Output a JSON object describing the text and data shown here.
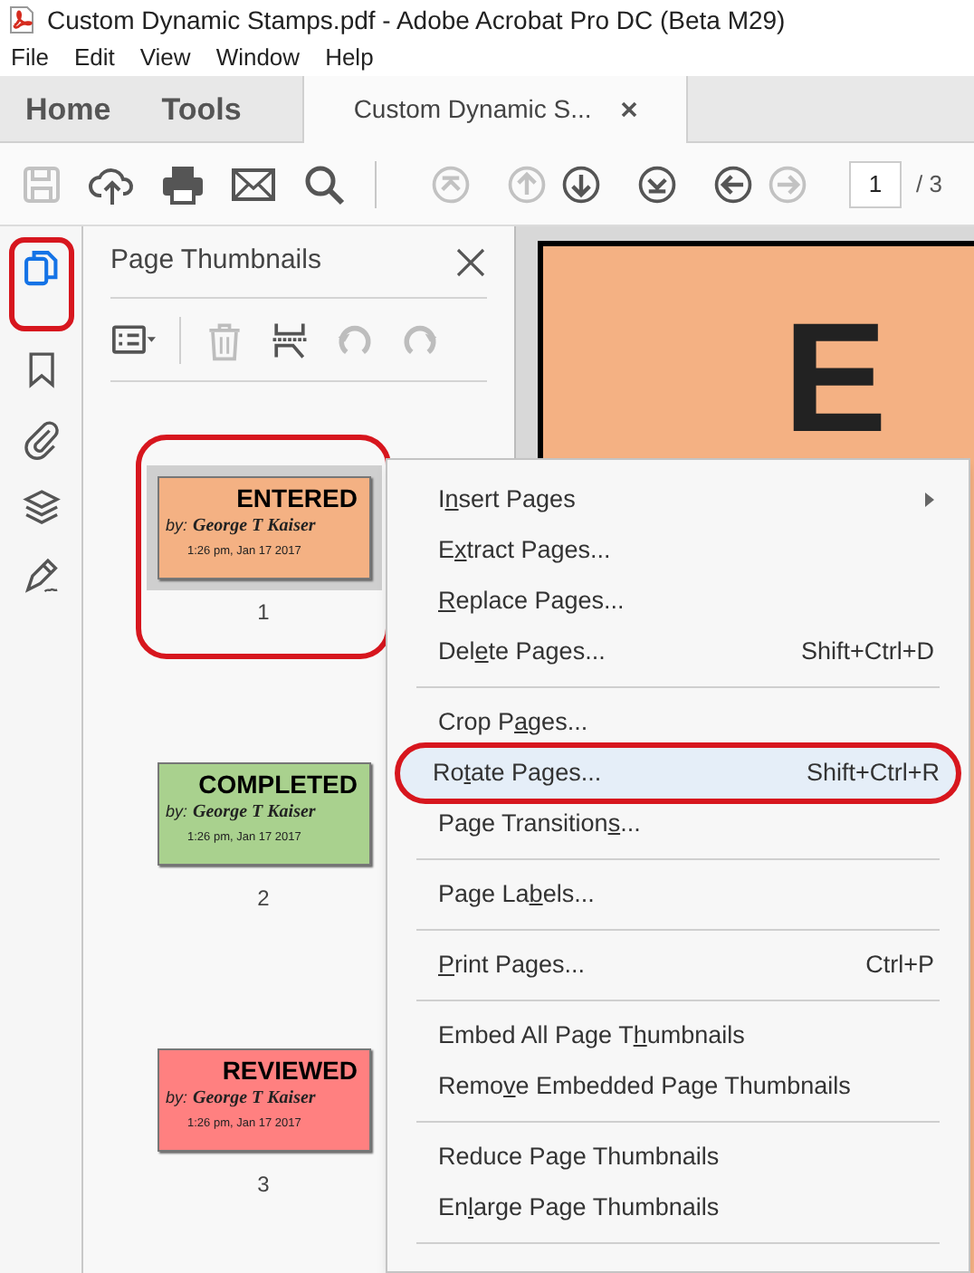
{
  "window": {
    "title": "Custom Dynamic Stamps.pdf - Adobe Acrobat Pro DC (Beta M29)"
  },
  "menu_bar": [
    "File",
    "Edit",
    "View",
    "Window",
    "Help"
  ],
  "tabs": [
    {
      "label": "Home",
      "kind": "nav",
      "selected": false
    },
    {
      "label": "Tools",
      "kind": "nav",
      "selected": false
    },
    {
      "label": "Custom Dynamic S...",
      "kind": "document",
      "selected": true
    }
  ],
  "toolbar": {
    "file_tools": [
      {
        "kind": "save",
        "disabled": true
      },
      {
        "kind": "upload",
        "disabled": false
      },
      {
        "kind": "print",
        "disabled": false
      },
      {
        "kind": "mail",
        "disabled": false
      },
      {
        "kind": "search",
        "disabled": false
      }
    ],
    "nav_tools": [
      {
        "kind": "first",
        "disabled": true
      },
      {
        "kind": "up",
        "disabled": true
      },
      {
        "kind": "down",
        "disabled": false
      },
      {
        "kind": "last",
        "disabled": false
      },
      {
        "kind": "back",
        "disabled": false
      },
      {
        "kind": "forward",
        "disabled": true
      }
    ],
    "page_field": {
      "value": "1"
    },
    "page_total": "/ 3"
  },
  "side_rail": [
    {
      "kind": "pages",
      "selected": true,
      "circled": true
    },
    {
      "kind": "bookmark",
      "selected": false,
      "circled": false
    },
    {
      "kind": "attachment",
      "selected": false,
      "circled": false
    },
    {
      "kind": "layers",
      "selected": false,
      "circled": false
    },
    {
      "kind": "signature",
      "selected": false,
      "circled": false
    }
  ],
  "thumbnails_panel": {
    "title": "Page Thumbnails",
    "tools": [
      {
        "kind": "options",
        "disabled": false
      },
      {
        "kind": "delete",
        "disabled": true
      },
      {
        "kind": "insert",
        "disabled": false
      },
      {
        "kind": "rotate_left",
        "disabled": true
      },
      {
        "kind": "rotate_right",
        "disabled": true
      }
    ],
    "pages": [
      {
        "label": "1",
        "selected": true,
        "circled": true,
        "stamp": {
          "title": "ENTERED",
          "by": "by:",
          "name": "George T Kaiser",
          "time": "1:26 pm, Jan 17 2017",
          "color": "#f4b183"
        }
      },
      {
        "label": "2",
        "selected": false,
        "circled": false,
        "stamp": {
          "title": "COMPLETED",
          "by": "by:",
          "name": "George T Kaiser",
          "time": "1:26 pm, Jan 17 2017",
          "color": "#a9d18e"
        }
      },
      {
        "label": "3",
        "selected": false,
        "circled": false,
        "stamp": {
          "title": "REVIEWED",
          "by": "by:",
          "name": "George T Kaiser",
          "time": "1:26 pm, Jan 17 2017",
          "color": "#ff8080"
        }
      }
    ]
  },
  "document": {
    "visible_text": "E",
    "color": "#f4b183"
  },
  "context_menu": {
    "items": [
      {
        "label": [
          "I",
          "n",
          "sert Pages"
        ],
        "submenu": true,
        "selected": false,
        "circled": false
      },
      {
        "label": [
          "E",
          "x",
          "tract Pages..."
        ],
        "selected": false,
        "circled": false
      },
      {
        "label": [
          "R",
          "eplace Pages..."
        ],
        "selected": false,
        "circled": false
      },
      {
        "label": [
          "Del",
          "e",
          "te Pages..."
        ],
        "shortcut": "Shift+Ctrl+D",
        "selected": false,
        "circled": false,
        "separator_after": true
      },
      {
        "label": [
          "Crop P",
          "a",
          "ges..."
        ],
        "selected": false,
        "circled": false
      },
      {
        "label": [
          "Ro",
          "t",
          "ate Pages..."
        ],
        "shortcut": "Shift+Ctrl+R",
        "selected": true,
        "circled": true
      },
      {
        "label": [
          "Page Transition",
          "s",
          "..."
        ],
        "selected": false,
        "circled": false,
        "separator_after": true
      },
      {
        "label": [
          "Page La",
          "b",
          "els..."
        ],
        "selected": false,
        "circled": false,
        "separator_after": true
      },
      {
        "label": [
          "P",
          "rint Pages..."
        ],
        "shortcut": "Ctrl+P",
        "selected": false,
        "circled": false,
        "separator_after": true
      },
      {
        "label": [
          "Embed All Page T",
          "h",
          "umbnails"
        ],
        "selected": false,
        "circled": false
      },
      {
        "label": [
          "Remo",
          "v",
          "e Embedded Page Thumbnails"
        ],
        "selected": false,
        "circled": false,
        "separator_after": true
      },
      {
        "label": [
          "Reduce Pa",
          "g",
          "e Thumbnails"
        ],
        "selected": false,
        "circled": false
      },
      {
        "label": [
          "En",
          "l",
          "arge Page Thumbnails"
        ],
        "selected": false,
        "circled": false,
        "separator_after": true
      }
    ]
  }
}
